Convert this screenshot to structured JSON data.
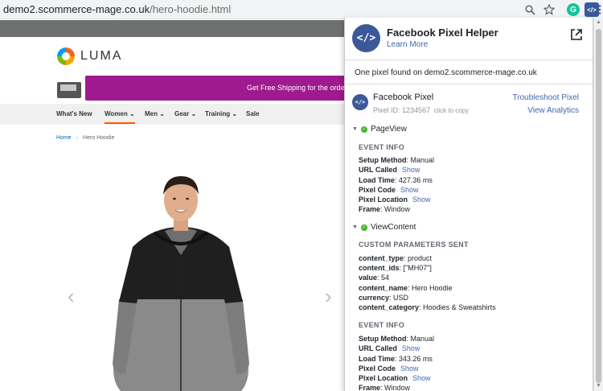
{
  "browser": {
    "url_host": "demo2.scommerce-mage.co.uk",
    "url_path": "/hero-hoodie.html",
    "icons": [
      "search-icon",
      "star-icon",
      "grammarly-icon",
      "pixel-helper-icon",
      "menu-icon"
    ],
    "grammarly_letter": "G",
    "pixel_ext_glyph": "</>"
  },
  "site": {
    "logo_text": "LUMA",
    "promo_text": "Get Free Shipping for the order ov",
    "nav": [
      "What's New",
      "Women",
      "Men",
      "Gear",
      "Training",
      "Sale"
    ],
    "active_nav": "Women",
    "breadcrumb": {
      "home": "Home",
      "current": "Hero Hoodie"
    },
    "prev_arrow": "‹",
    "next_arrow": "›",
    "accent_color": "#ff5501",
    "promo_color": "#9f1a8e"
  },
  "popup": {
    "logo_glyph": "</>",
    "title": "Facebook Pixel Helper",
    "learn_more": "Learn More",
    "found_text": "One pixel found on demo2.scommerce-mage.co.uk",
    "pixel_name": "Facebook Pixel",
    "pixel_id_label": "Pixel ID: 1234567",
    "click_to_copy": "click to copy",
    "troubleshoot": "Troubleshoot Pixel",
    "view_analytics": "View Analytics",
    "events": [
      {
        "name": "PageView",
        "sections": [
          {
            "title": "EVENT INFO",
            "rows": [
              {
                "key": "Setup Method",
                "value": "Manual"
              },
              {
                "key": "URL Called",
                "link": "Show"
              },
              {
                "key": "Load Time",
                "value": "427.36 ms"
              },
              {
                "key": "Pixel Code",
                "link": "Show"
              },
              {
                "key": "Pixel Location",
                "link": "Show"
              },
              {
                "key": "Frame",
                "value": "Window"
              }
            ]
          }
        ]
      },
      {
        "name": "ViewContent",
        "sections": [
          {
            "title": "CUSTOM PARAMETERS SENT",
            "rows": [
              {
                "key": "content_type",
                "value": "product"
              },
              {
                "key": "content_ids",
                "value": "[\"MH07\"]"
              },
              {
                "key": "value",
                "value": "54"
              },
              {
                "key": "content_name",
                "value": "Hero Hoodie"
              },
              {
                "key": "currency",
                "value": "USD"
              },
              {
                "key": "content_category",
                "value": "Hoodies & Sweatshirts"
              }
            ]
          },
          {
            "title": "EVENT INFO",
            "rows": [
              {
                "key": "Setup Method",
                "value": "Manual"
              },
              {
                "key": "URL Called",
                "link": "Show"
              },
              {
                "key": "Load Time",
                "value": "343.26 ms"
              },
              {
                "key": "Pixel Code",
                "link": "Show"
              },
              {
                "key": "Pixel Location",
                "link": "Show"
              },
              {
                "key": "Frame",
                "value": "Window"
              }
            ]
          }
        ]
      }
    ]
  }
}
